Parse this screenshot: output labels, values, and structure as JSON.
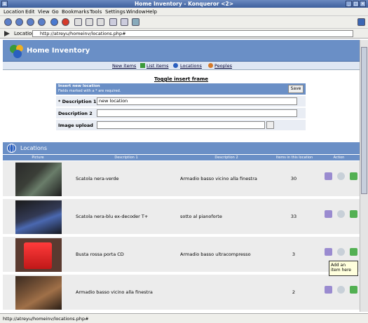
{
  "window": {
    "title": "Home Inventory - Konqueror <2>"
  },
  "menu": {
    "items": [
      "Location",
      "Edit",
      "View",
      "Go",
      "Bookmarks",
      "Tools",
      "Settings",
      "Window",
      "Help"
    ]
  },
  "location_bar": {
    "label": "Location:",
    "url": "http://atreyu/homeinv/locations.php#"
  },
  "app": {
    "title": "Home Inventory"
  },
  "nav": {
    "new_items": "New items",
    "list_items": "List items",
    "locations": "Locations",
    "peoples": "Peoples"
  },
  "toggle": "Toggle insert frame",
  "form": {
    "heading": "Insert new location",
    "note": "Fields marked with a * are required.",
    "save": "Save",
    "desc1_label": "* Description 1",
    "desc1_value": "new location",
    "desc2_label": "Description 2",
    "desc2_value": "",
    "upload_label": "Image upload",
    "upload_value": ""
  },
  "locations": {
    "title": "Locations",
    "columns": [
      "Picture",
      "Description 1",
      "Description 2",
      "Items in this location",
      "Action"
    ],
    "rows": [
      {
        "d1": "Scatola nera-verde",
        "d2": "Armadio basso vicino alla finestra",
        "count": "30"
      },
      {
        "d1": "Scatola nera-blu ex-decoder T+",
        "d2": "sotto al pianoforte",
        "count": "33"
      },
      {
        "d1": "Busta rossa porta CD",
        "d2": "Armadio basso ultracompresso",
        "count": "3"
      },
      {
        "d1": "Armadio basso vicino alla finestra",
        "d2": "",
        "count": "2"
      }
    ]
  },
  "tooltip": "Add an item here",
  "status": "http://atreyu/homeinv/locations.php#",
  "colors": {
    "header_blue": "#6a8fc6",
    "row_grey": "#ececec"
  }
}
